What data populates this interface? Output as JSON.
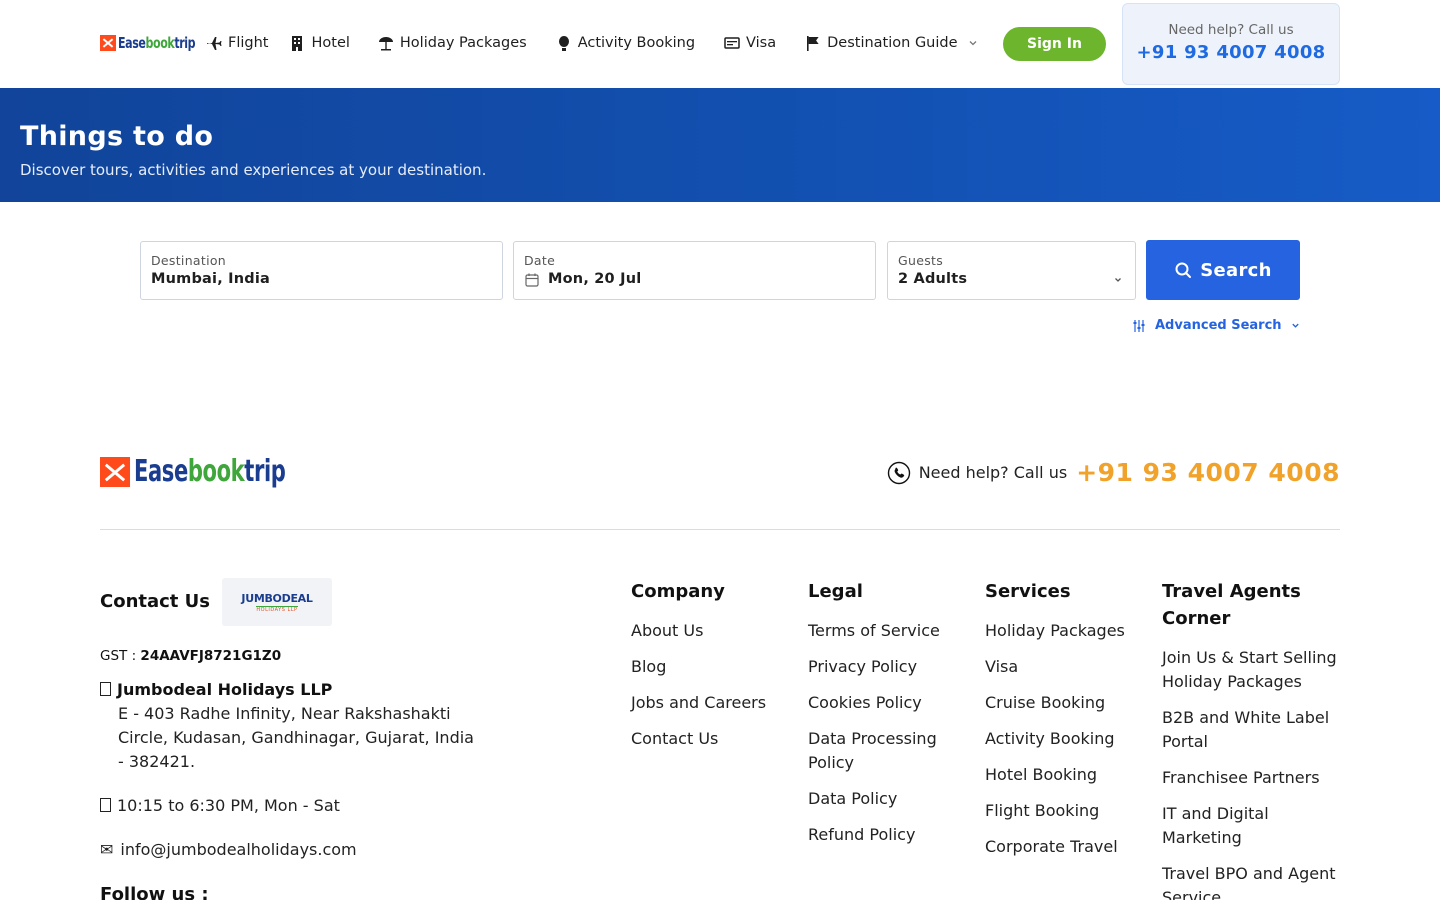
{
  "brand": {
    "part1": "Ease",
    "part2": "book",
    "part3": "trip"
  },
  "nav": [
    {
      "label": "Flight",
      "icon": "plane-icon"
    },
    {
      "label": "Hotel",
      "icon": "building-icon"
    },
    {
      "label": "Holiday Packages",
      "icon": "beach-umbrella-icon"
    },
    {
      "label": "Activity Booking",
      "icon": "hot-air-balloon-icon"
    },
    {
      "label": "Visa",
      "icon": "passport-card-icon"
    },
    {
      "label": "Destination Guide",
      "icon": "flag-icon"
    }
  ],
  "signin_label": "Sign In",
  "help": {
    "text": "Need help? Call us",
    "phone": "+91 93 4007 4008"
  },
  "hero": {
    "title": "Things to do",
    "subtitle": "Discover tours, activities and experiences at your destination."
  },
  "search": {
    "destination": {
      "label": "Destination",
      "value": "Mumbai, India"
    },
    "date": {
      "label": "Date",
      "value": "Mon, 20 Jul"
    },
    "guests": {
      "label": "Guests",
      "value": "2 Adults"
    },
    "button": "Search",
    "advanced": "Advanced Search"
  },
  "footer": {
    "help_text": "Need help? Call us",
    "help_phone": "+91 93 4007 4008",
    "contact": {
      "heading": "Contact Us",
      "partner_logo": "JUMBODEAL",
      "partner_logo_sub": "HOLIDAYS LLP",
      "gst_label": "GST :",
      "gst": "24AAVFJ8721G1Z0",
      "company": "Jumbodeal Holidays LLP",
      "address": "E - 403 Radhe Infinity, Near Rakshashakti Circle, Kudasan, Gandhinagar, Gujarat, India - 382421.",
      "hours": "10:15 to 6:30 PM, Mon - Sat",
      "email": "info@jumbodealholidays.com",
      "follow": "Follow us :"
    },
    "columns": [
      {
        "heading": "Company",
        "links": [
          "About Us",
          "Blog",
          "Jobs and Careers",
          "Contact Us"
        ]
      },
      {
        "heading": "Legal",
        "links": [
          "Terms of Service",
          "Privacy Policy",
          "Cookies Policy",
          "Data Processing Policy",
          "Data Policy",
          "Refund Policy"
        ]
      },
      {
        "heading": "Services",
        "links": [
          "Holiday Packages",
          "Visa",
          "Cruise Booking",
          "Activity Booking",
          "Hotel Booking",
          "Flight Booking",
          "Corporate Travel"
        ]
      },
      {
        "heading": "Travel Agents Corner",
        "links": [
          "Join Us & Start Selling Holiday Packages",
          "B2B and White Label Portal",
          "Franchisee Partners",
          "IT and Digital Marketing",
          "Travel BPO and Agent Service"
        ]
      }
    ]
  },
  "colors": {
    "primary": "#2563e0",
    "green": "#6cb52d",
    "orange": "#f0a22a",
    "hero": "#124fae"
  }
}
